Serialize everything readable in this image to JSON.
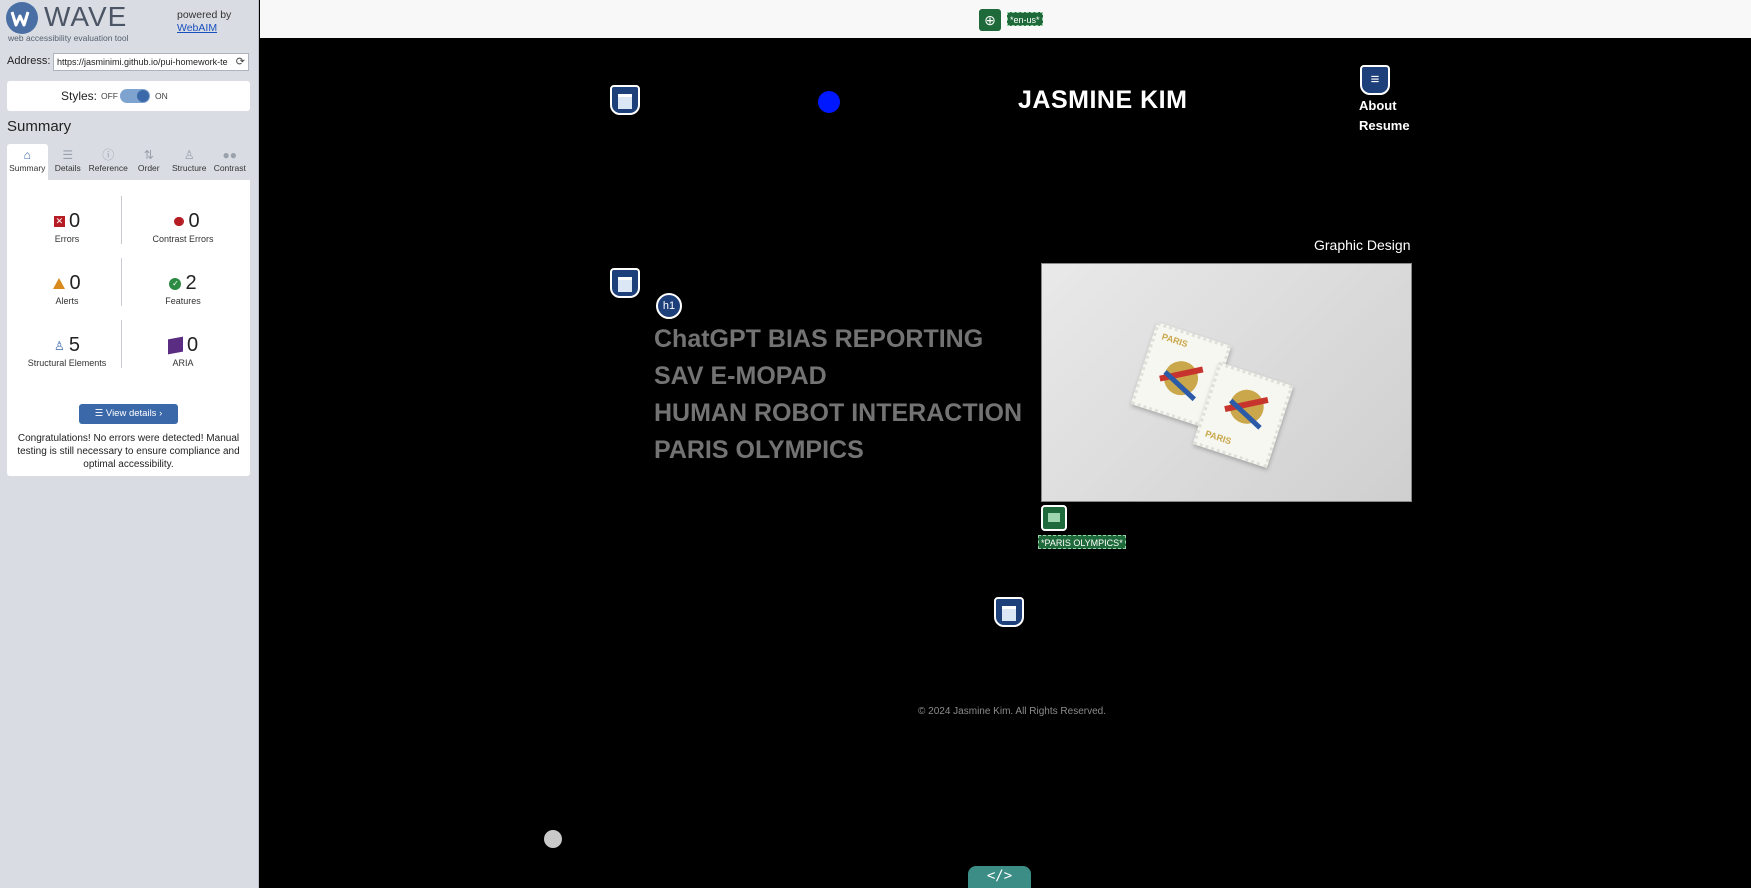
{
  "wave": {
    "logo_text": "WAVE",
    "logo_sub": "web accessibility evaluation tool",
    "powered_by": "powered by",
    "webaim_link": "WebAIM",
    "address_label": "Address:",
    "address_value": "https://jasminimi.github.io/pui-homework-te",
    "styles_label": "Styles:",
    "styles_off": "OFF",
    "styles_on": "ON",
    "summary_title": "Summary",
    "tabs": [
      {
        "label": "Summary",
        "icon": "home-icon",
        "active": true
      },
      {
        "label": "Details",
        "icon": "list-icon",
        "active": false
      },
      {
        "label": "Reference",
        "icon": "info-icon",
        "active": false
      },
      {
        "label": "Order",
        "icon": "order-icon",
        "active": false
      },
      {
        "label": "Structure",
        "icon": "structure-icon",
        "active": false
      },
      {
        "label": "Contrast",
        "icon": "contrast-icon",
        "active": false
      }
    ],
    "stats": {
      "errors": {
        "count": "0",
        "label": "Errors"
      },
      "contrast_errors": {
        "count": "0",
        "label": "Contrast Errors"
      },
      "alerts": {
        "count": "0",
        "label": "Alerts"
      },
      "features": {
        "count": "2",
        "label": "Features"
      },
      "structural": {
        "count": "5",
        "label": "Structural Elements"
      },
      "aria": {
        "count": "0",
        "label": "ARIA"
      }
    },
    "view_details": "View details ›",
    "congrats": "Congratulations! No errors were detected! Manual testing is still necessary to ensure compliance and optimal accessibility."
  },
  "page": {
    "lang_tag": "*en-us*",
    "site_title": "JASMINE KIM",
    "nav": {
      "about": "About",
      "resume": "Resume"
    },
    "section_label": "Graphic Design",
    "h1_badge": "h1",
    "projects": [
      "ChatGPT BIAS REPORTING",
      "SAV E-MOPAD",
      "HUMAN ROBOT INTERACTION",
      "PARIS OLYMPICS"
    ],
    "image_alt_tag": "*PARIS OLYMPICS*",
    "stamp_text": "PARIS",
    "footer": "© 2024 Jasmine Kim. All Rights Reserved.",
    "code_tab": "</>"
  },
  "colors": {
    "wave_blue": "#3b68a8",
    "wave_error": "#b61c24",
    "wave_alert": "#d98a1c",
    "wave_feature": "#2d8a42",
    "page_bg": "#000000",
    "project_text": "#737373"
  }
}
